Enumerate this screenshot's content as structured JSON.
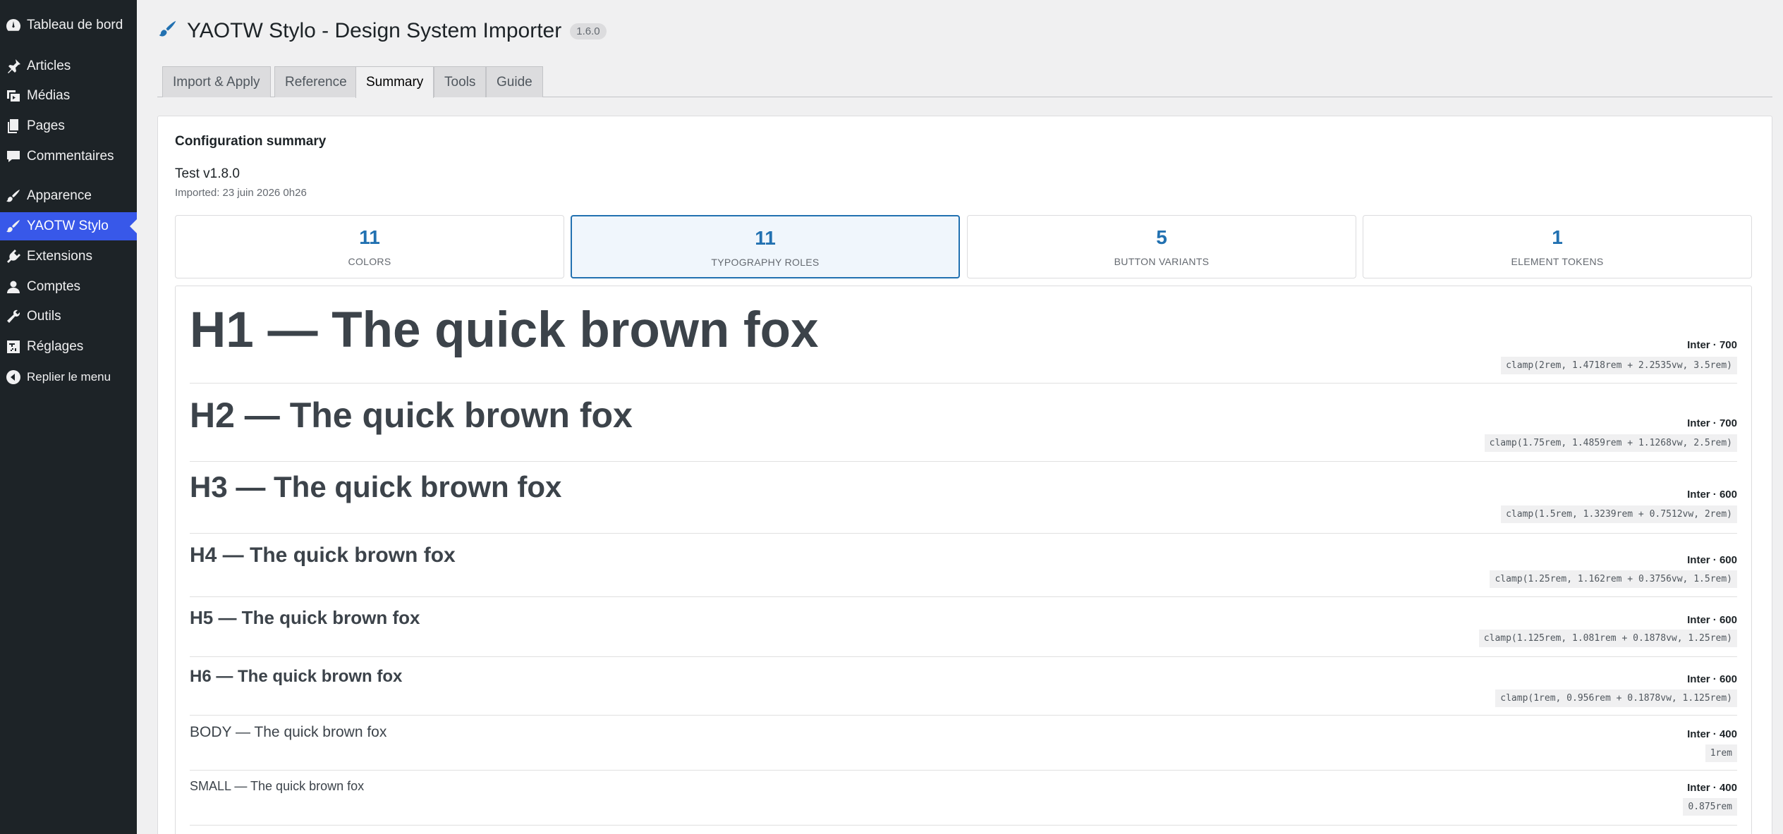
{
  "sidebar": {
    "items": [
      {
        "label": "Tableau de bord",
        "icon": "dashboard-icon"
      },
      {
        "label": "Articles",
        "icon": "pin-icon"
      },
      {
        "label": "Médias",
        "icon": "media-icon"
      },
      {
        "label": "Pages",
        "icon": "pages-icon"
      },
      {
        "label": "Commentaires",
        "icon": "comment-icon"
      },
      {
        "label": "Apparence",
        "icon": "brush-icon"
      },
      {
        "label": "YAOTW Stylo",
        "icon": "brush-icon"
      },
      {
        "label": "Extensions",
        "icon": "plugin-icon"
      },
      {
        "label": "Comptes",
        "icon": "user-icon"
      },
      {
        "label": "Outils",
        "icon": "wrench-icon"
      },
      {
        "label": "Réglages",
        "icon": "settings-icon"
      },
      {
        "label": "Replier le menu",
        "icon": "collapse-icon"
      }
    ],
    "active_color": "#3858e9"
  },
  "header": {
    "title": "YAOTW Stylo - Design System Importer",
    "version": "1.6.0"
  },
  "tabs": [
    {
      "label": "Import & Apply"
    },
    {
      "label": "Reference"
    },
    {
      "label": "Summary"
    },
    {
      "label": "Tools"
    },
    {
      "label": "Guide"
    }
  ],
  "summary": {
    "heading": "Configuration summary",
    "config_name": "Test v1.8.0",
    "imported": "Imported: 23 juin 2026 0h26",
    "stats": [
      {
        "value": "11",
        "label": "COLORS"
      },
      {
        "value": "11",
        "label": "TYPOGRAPHY ROLES"
      },
      {
        "value": "5",
        "label": "BUTTON VARIANTS"
      },
      {
        "value": "1",
        "label": "ELEMENT TOKENS"
      }
    ]
  },
  "typography": [
    {
      "sample": "H1 — The quick brown fox",
      "meta": "Inter · 700",
      "value": "clamp(2rem, 1.4718rem + 2.2535vw, 3.5rem)"
    },
    {
      "sample": "H2 — The quick brown fox",
      "meta": "Inter · 700",
      "value": "clamp(1.75rem, 1.4859rem + 1.1268vw, 2.5rem)"
    },
    {
      "sample": "H3 — The quick brown fox",
      "meta": "Inter · 600",
      "value": "clamp(1.5rem, 1.3239rem + 0.7512vw, 2rem)"
    },
    {
      "sample": "H4 — The quick brown fox",
      "meta": "Inter · 600",
      "value": "clamp(1.25rem, 1.162rem + 0.3756vw, 1.5rem)"
    },
    {
      "sample": "H5 — The quick brown fox",
      "meta": "Inter · 600",
      "value": "clamp(1.125rem, 1.081rem + 0.1878vw, 1.25rem)"
    },
    {
      "sample": "H6 — The quick brown fox",
      "meta": "Inter · 600",
      "value": "clamp(1rem, 0.956rem + 0.1878vw, 1.125rem)"
    },
    {
      "sample": "BODY — The quick brown fox",
      "meta": "Inter · 400",
      "value": "1rem"
    },
    {
      "sample": "SMALL — The quick brown fox",
      "meta": "Inter · 400",
      "value": "0.875rem"
    }
  ]
}
